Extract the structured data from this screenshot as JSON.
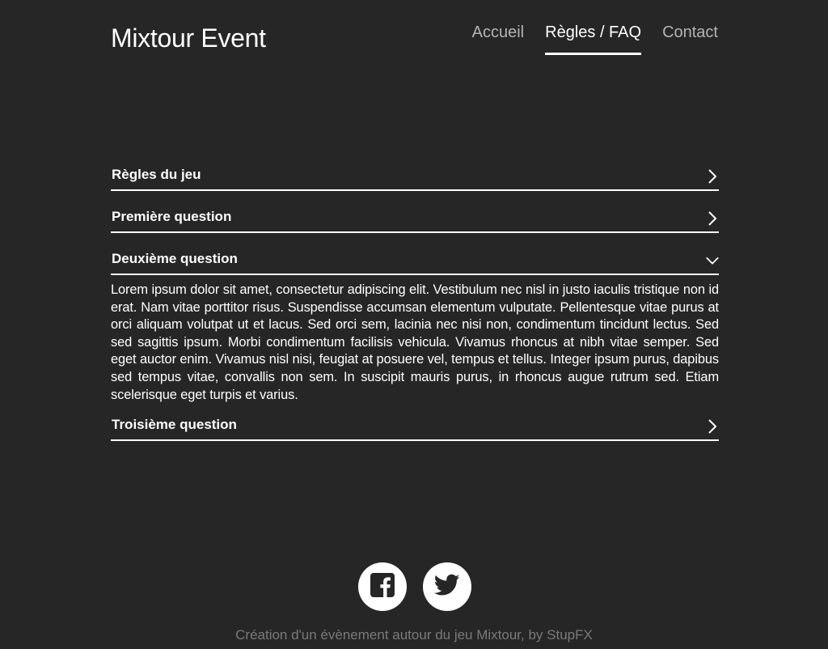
{
  "header": {
    "brand": "Mixtour Event",
    "nav": [
      {
        "label": "Accueil",
        "active": false
      },
      {
        "label": "Règles / FAQ",
        "active": true
      },
      {
        "label": "Contact",
        "active": false
      }
    ]
  },
  "faq": {
    "items": [
      {
        "title": "Règles du jeu",
        "expanded": false,
        "icon": "chevron-right-icon"
      },
      {
        "title": "Première question",
        "expanded": false,
        "icon": "chevron-right-icon"
      },
      {
        "title": "Deuxième question",
        "expanded": true,
        "icon": "chevron-down-icon",
        "answer": "Lorem ipsum dolor sit amet, consectetur adipiscing elit. Vestibulum nec nisl in justo iaculis tristique non id erat. Nam vitae porttitor risus. Suspendisse accumsan elementum vulputate. Pellentesque vitae purus at orci aliquam volutpat ut et lacus. Sed orci sem, lacinia nec nisi non, condimentum tincidunt lectus. Sed sed sagittis ipsum. Morbi condimentum facilisis vehicula. Vivamus rhoncus at nibh vitae semper. Sed eget auctor enim. Vivamus nisl nisi, feugiat at posuere vel, tempus et tellus. Integer ipsum purus, dapibus sed tempus vitae, convallis non sem. In suscipit mauris purus, in rhoncus augue rutrum sed. Etiam scelerisque eget turpis et varius."
      },
      {
        "title": "Troisième question",
        "expanded": false,
        "icon": "chevron-right-icon"
      }
    ]
  },
  "footer": {
    "social": [
      {
        "name": "facebook-icon"
      },
      {
        "name": "twitter-icon"
      }
    ],
    "credits": "Création d'un évènement autour du jeu Mixtour, by StupFX"
  },
  "colors": {
    "background": "#262626",
    "text": "#ffffff",
    "nav_inactive": "#b4b4b4",
    "credits": "#7a7a7a"
  }
}
